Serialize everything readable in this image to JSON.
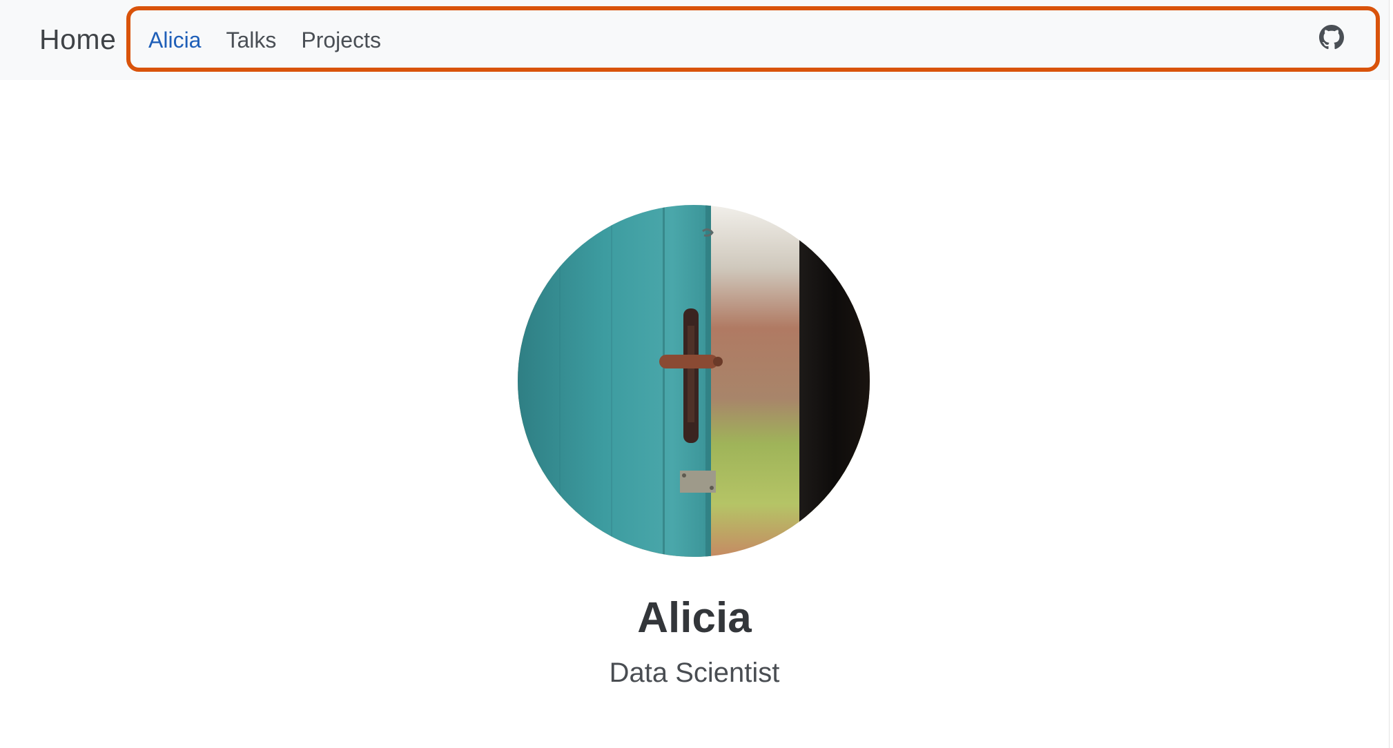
{
  "navbar": {
    "brand": "Home",
    "links": [
      {
        "label": "Alicia",
        "active": true
      },
      {
        "label": "Talks",
        "active": false
      },
      {
        "label": "Projects",
        "active": false
      }
    ],
    "github_icon": "github-icon"
  },
  "profile": {
    "avatar_image": "open-teal-door-photo",
    "name": "Alicia",
    "title": "Data Scientist"
  },
  "colors": {
    "accent": "#1f5fb8",
    "highlight": "#d9530b",
    "navbar_bg": "#f8f9fa",
    "door_teal": "#3f9fa3"
  }
}
